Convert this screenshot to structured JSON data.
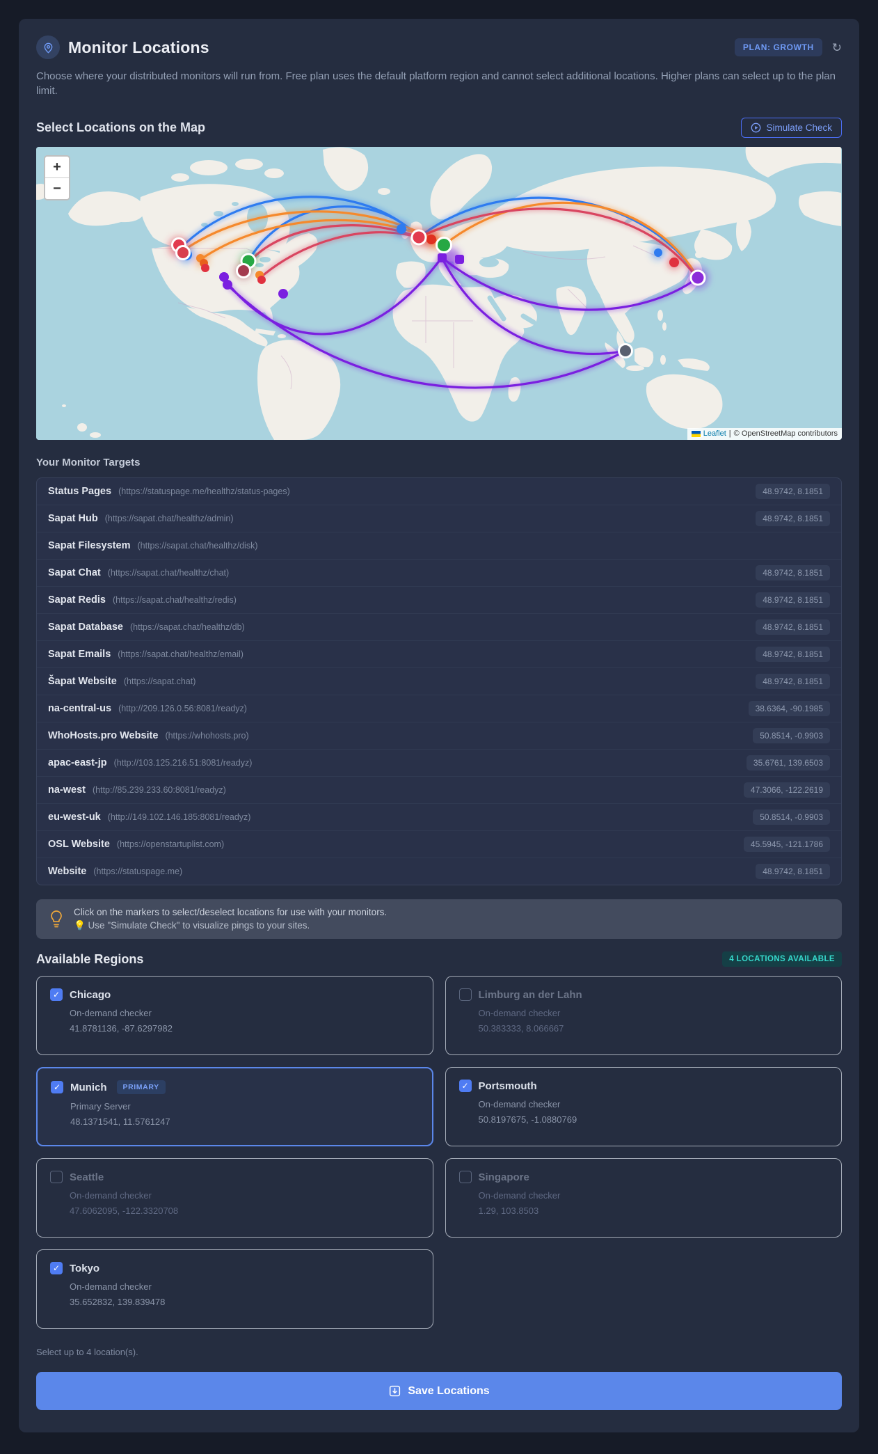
{
  "header": {
    "title": "Monitor Locations",
    "plan_badge": "PLAN: GROWTH",
    "description": "Choose where your distributed monitors will run from. Free plan uses the default platform region and cannot select additional locations. Higher plans can select up to the plan limit."
  },
  "icons": {
    "refresh": "↻",
    "check": "✓",
    "pin": "location-pin",
    "play": "play-circle",
    "save": "save-arrow",
    "bulb": "lightbulb"
  },
  "map_section": {
    "title": "Select Locations on the Map",
    "simulate_button": "Simulate Check",
    "zoom_in": "+",
    "zoom_out": "−",
    "attribution": {
      "leaflet_link": "Leaflet",
      "separator": "|",
      "osm_text": "© OpenStreetMap contributors"
    }
  },
  "targets": {
    "title": "Your Monitor Targets",
    "rows": [
      {
        "name": "Status Pages",
        "url": "(https://statuspage.me/healthz/status-pages)",
        "coords": "48.9742, 8.1851"
      },
      {
        "name": "Sapat Hub",
        "url": "(https://sapat.chat/healthz/admin)",
        "coords": "48.9742, 8.1851"
      },
      {
        "name": "Sapat Filesystem",
        "url": "(https://sapat.chat/healthz/disk)",
        "coords": ""
      },
      {
        "name": "Sapat Chat",
        "url": "(https://sapat.chat/healthz/chat)",
        "coords": "48.9742, 8.1851"
      },
      {
        "name": "Sapat Redis",
        "url": "(https://sapat.chat/healthz/redis)",
        "coords": "48.9742, 8.1851"
      },
      {
        "name": "Sapat Database",
        "url": "(https://sapat.chat/healthz/db)",
        "coords": "48.9742, 8.1851"
      },
      {
        "name": "Sapat Emails",
        "url": "(https://sapat.chat/healthz/email)",
        "coords": "48.9742, 8.1851"
      },
      {
        "name": "Šapat Website",
        "url": "(https://sapat.chat)",
        "coords": "48.9742, 8.1851"
      },
      {
        "name": "na-central-us",
        "url": "(http://209.126.0.56:8081/readyz)",
        "coords": "38.6364, -90.1985"
      },
      {
        "name": "WhoHosts.pro Website",
        "url": "(https://whohosts.pro)",
        "coords": "50.8514, -0.9903"
      },
      {
        "name": "apac-east-jp",
        "url": "(http://103.125.216.51:8081/readyz)",
        "coords": "35.6761, 139.6503"
      },
      {
        "name": "na-west",
        "url": "(http://85.239.233.60:8081/readyz)",
        "coords": "47.3066, -122.2619"
      },
      {
        "name": "eu-west-uk",
        "url": "(http://149.102.146.185:8081/readyz)",
        "coords": "50.8514, -0.9903"
      },
      {
        "name": "OSL Website",
        "url": "(https://openstartuplist.com)",
        "coords": "45.5945, -121.1786"
      },
      {
        "name": "Website",
        "url": "(https://statuspage.me)",
        "coords": "48.9742, 8.1851"
      }
    ]
  },
  "tip": {
    "line1": "Click on the markers to select/deselect locations for use with your monitors.",
    "line2": "💡 Use \"Simulate Check\" to visualize pings to your sites."
  },
  "regions": {
    "title": "Available Regions",
    "badge": "4 LOCATIONS AVAILABLE",
    "footnote": "Select up to 4 location(s).",
    "cards": [
      {
        "name": "Chicago",
        "sub": "On-demand checker",
        "coords": "41.8781136, -87.6297982",
        "checked": true,
        "primary": false,
        "disabled": false
      },
      {
        "name": "Limburg an der Lahn",
        "sub": "On-demand checker",
        "coords": "50.383333, 8.066667",
        "checked": false,
        "primary": false,
        "disabled": true
      },
      {
        "name": "Munich",
        "badge": "PRIMARY",
        "sub": "Primary Server",
        "coords": "48.1371541, 11.5761247",
        "checked": true,
        "primary": true,
        "disabled": false
      },
      {
        "name": "Portsmouth",
        "sub": "On-demand checker",
        "coords": "50.8197675, -1.0880769",
        "checked": true,
        "primary": false,
        "disabled": false
      },
      {
        "name": "Seattle",
        "sub": "On-demand checker",
        "coords": "47.6062095, -122.3320708",
        "checked": false,
        "primary": false,
        "disabled": true
      },
      {
        "name": "Singapore",
        "sub": "On-demand checker",
        "coords": "1.29, 103.8503",
        "checked": false,
        "primary": false,
        "disabled": true
      },
      {
        "name": "Tokyo",
        "sub": "On-demand checker",
        "coords": "35.652832, 139.839478",
        "checked": true,
        "primary": false,
        "disabled": false
      }
    ]
  },
  "save_button": {
    "label": "Save Locations"
  },
  "colors": {
    "accent_blue": "#5b87ea",
    "teal": "#36d9cc",
    "map_water": "#aad3df",
    "map_land": "#f2efe9",
    "arc_blue": "#2e7bf0",
    "arc_orange": "#f5892c",
    "arc_red": "#d94560",
    "arc_purple": "#7a1fe0",
    "marker_green": "#27a844",
    "marker_red": "#e23b4e",
    "marker_maroon": "#a33b4f",
    "marker_gray": "#596070"
  }
}
